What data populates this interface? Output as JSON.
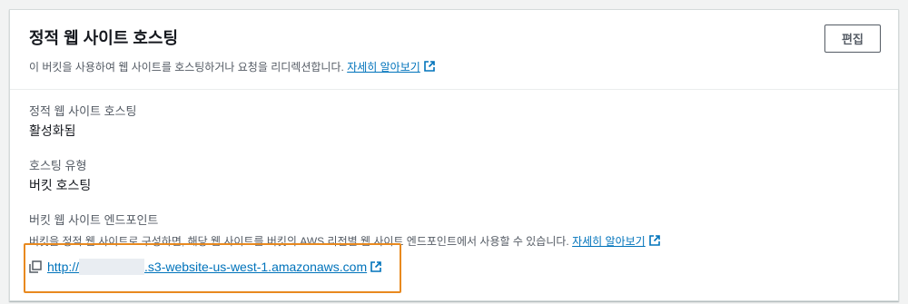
{
  "header": {
    "title": "정적 웹 사이트 호스팅",
    "description": "이 버킷을 사용하여 웹 사이트를 호스팅하거나 요청을 리디렉션합니다.",
    "learn_more": "자세히 알아보기",
    "edit_label": "편집"
  },
  "fields": {
    "hosting": {
      "label": "정적 웹 사이트 호스팅",
      "value": "활성화됨"
    },
    "hosting_type": {
      "label": "호스팅 유형",
      "value": "버킷 호스팅"
    },
    "endpoint": {
      "label": "버킷 웹 사이트 엔드포인트",
      "description": "버킷을 정적 웹 사이트로 구성하면, 해당 웹 사이트를 버킷의 AWS 리전별 웹 사이트 엔드포인트에서 사용할 수 있습니다.",
      "learn_more": "자세히 알아보기",
      "url_prefix": "http://",
      "url_suffix": ".s3-website-us-west-1.amazonaws.com"
    }
  },
  "colors": {
    "link": "#0073bb",
    "highlight": "#e8891f"
  },
  "icons": {
    "external_link": "external-link-icon",
    "copy": "copy-icon"
  }
}
